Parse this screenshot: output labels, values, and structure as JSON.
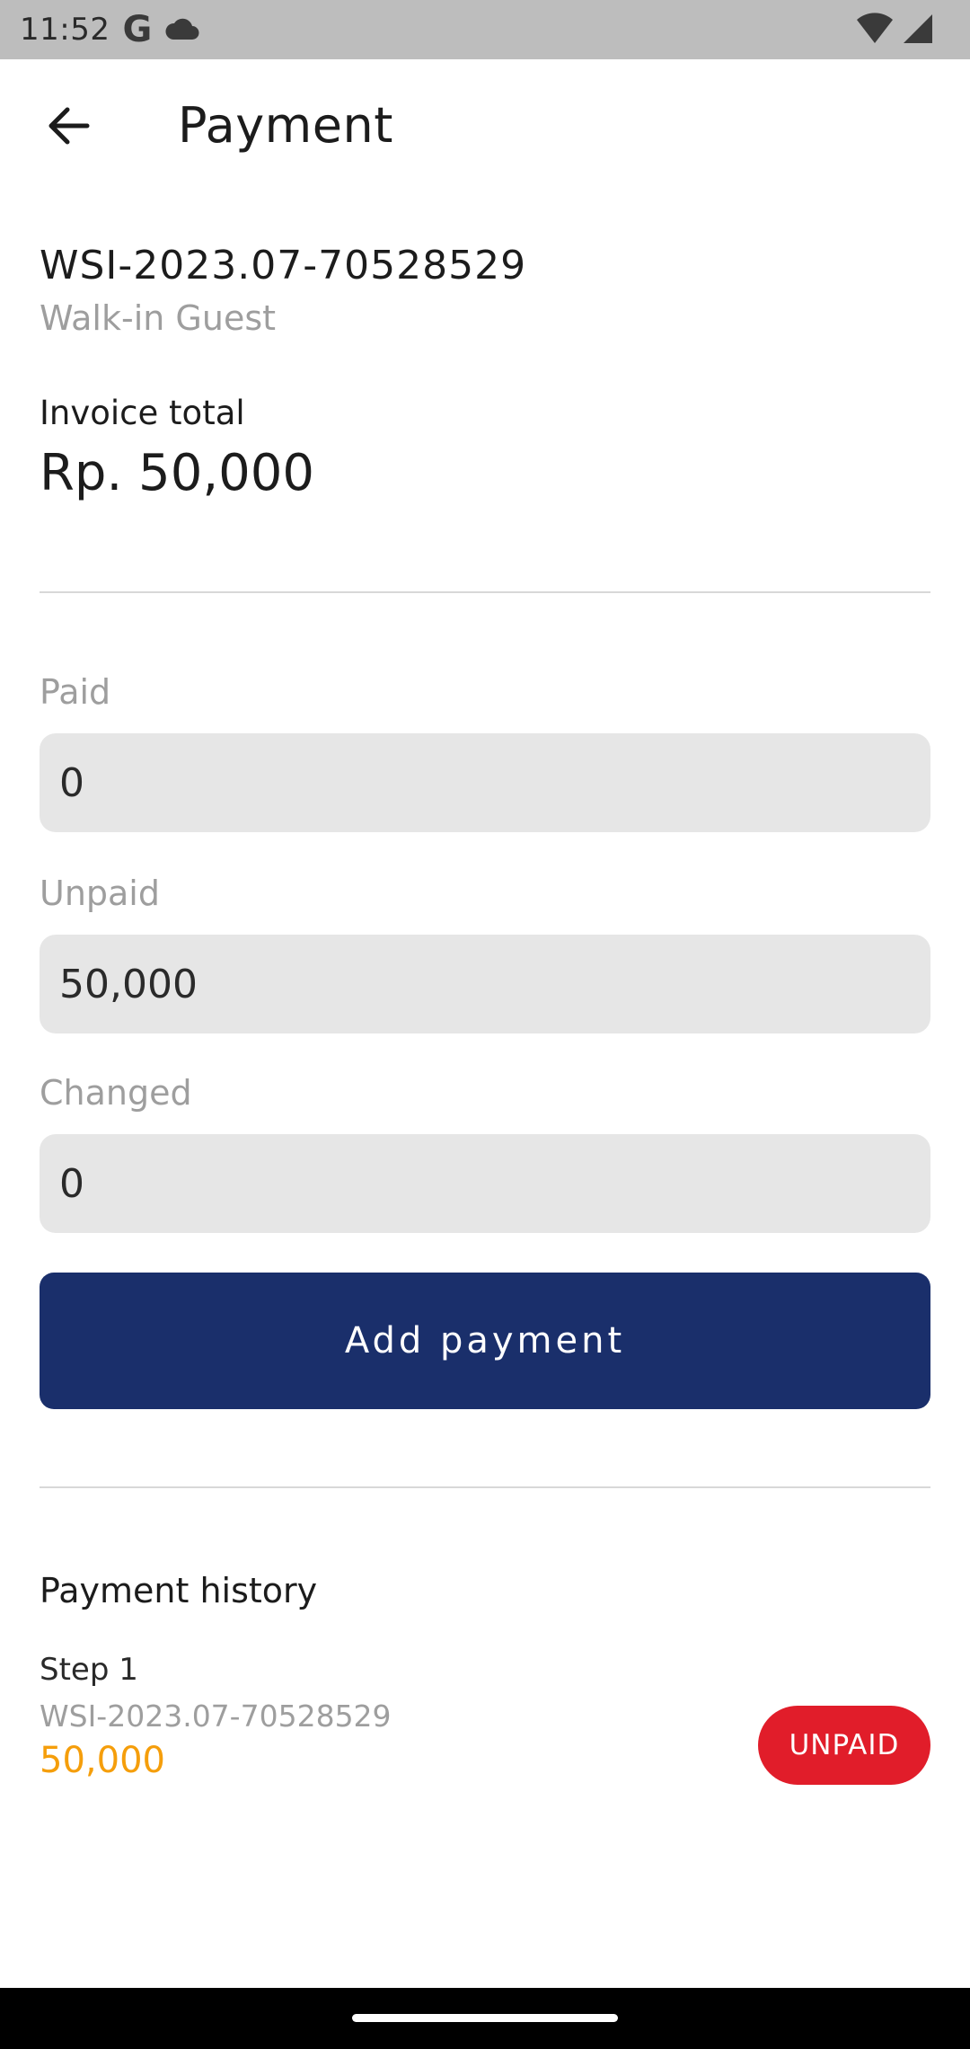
{
  "status_bar": {
    "time": "11:52",
    "g_letter": "G",
    "icons": [
      "google-icon",
      "cloud-icon",
      "wifi-icon",
      "signal-icon"
    ]
  },
  "app_bar": {
    "title": "Payment",
    "back_icon": "arrow-back-icon"
  },
  "invoice": {
    "number": "WSI-2023.07-70528529",
    "guest": "Walk-in Guest",
    "total_label": "Invoice total",
    "total_value": "Rp. 50,000"
  },
  "fields": {
    "paid": {
      "label": "Paid",
      "value": "0"
    },
    "unpaid": {
      "label": "Unpaid",
      "value": "50,000"
    },
    "changed": {
      "label": "Changed",
      "value": "0"
    }
  },
  "actions": {
    "add_payment": "Add payment"
  },
  "history": {
    "title": "Payment history",
    "items": [
      {
        "step": "Step 1",
        "invoice": "WSI-2023.07-70528529",
        "amount": "50,000",
        "status": "UNPAID"
      }
    ]
  },
  "colors": {
    "primary": "#1a2f6b",
    "unpaid_badge": "#e11d2a",
    "amount": "#f59e0b",
    "field_bg": "#e6e6e6",
    "muted_text": "#9e9e9e"
  }
}
